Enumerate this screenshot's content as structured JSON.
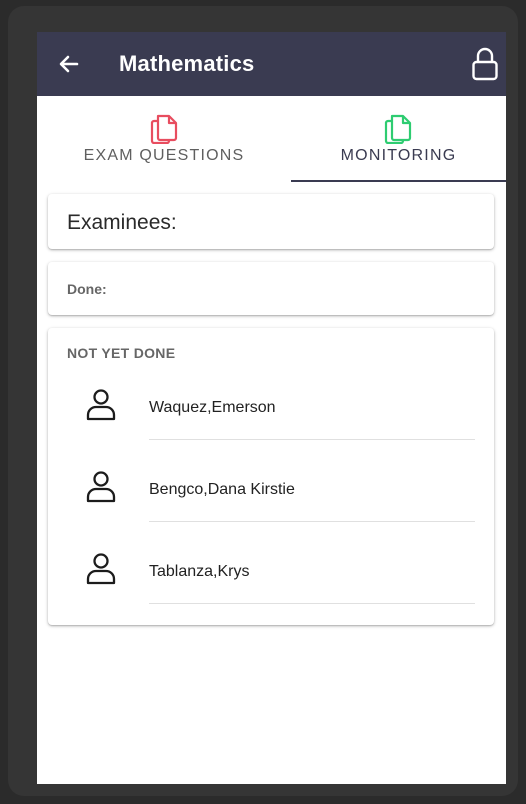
{
  "appbar": {
    "title": "Mathematics",
    "back_icon": "arrow-left-icon",
    "lock_icon": "lock-icon"
  },
  "tabs": [
    {
      "label": "EXAM QUESTIONS",
      "icon": "copy-icon",
      "icon_color": "#e84d5f",
      "selected": false
    },
    {
      "label": "MONITORING",
      "icon": "copy-icon",
      "icon_color": "#2ecc71",
      "selected": true
    }
  ],
  "colors": {
    "appbar": "#3a3b51",
    "exam_tab_icon": "#e84d5f",
    "monitoring_tab_icon": "#2ecc71"
  },
  "examinees_card": {
    "title": "Examinees:"
  },
  "done_card": {
    "label": "Done:"
  },
  "not_done_card": {
    "header": "NOT YET DONE",
    "examinees": [
      {
        "name": "Waquez,Emerson",
        "icon": "person-icon"
      },
      {
        "name": "Bengco,Dana Kirstie",
        "icon": "person-icon"
      },
      {
        "name": "Tablanza,Krys",
        "icon": "person-icon"
      }
    ]
  }
}
